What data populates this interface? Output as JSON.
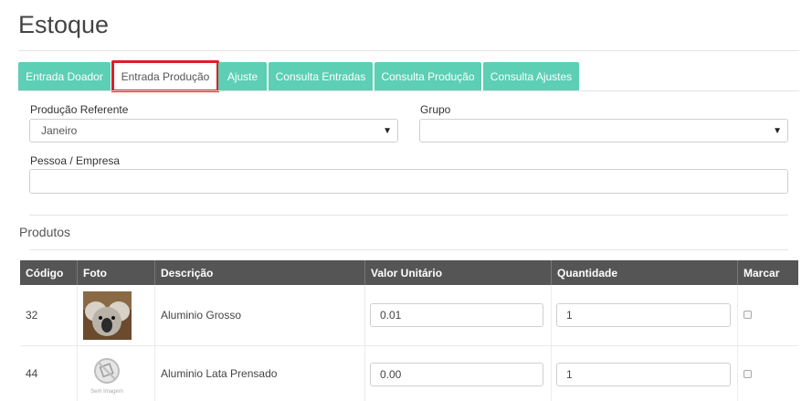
{
  "page": {
    "title": "Estoque"
  },
  "tabs": [
    {
      "label": "Entrada Doador"
    },
    {
      "label": "Entrada Produção"
    },
    {
      "label": "Ajuste"
    },
    {
      "label": "Consulta Entradas"
    },
    {
      "label": "Consulta Produção"
    },
    {
      "label": "Consulta Ajustes"
    }
  ],
  "active_tab": "Entrada Produção",
  "form": {
    "producao_label": "Produção Referente",
    "producao_value": "Janeiro",
    "grupo_label": "Grupo",
    "grupo_value": "",
    "pessoa_label": "Pessoa / Empresa",
    "pessoa_value": ""
  },
  "products": {
    "title": "Produtos",
    "columns": [
      "Código",
      "Foto",
      "Descrição",
      "Valor Unitário",
      "Quantidade",
      "Marcar"
    ],
    "rows": [
      {
        "codigo": "32",
        "foto": "koala-photo",
        "descricao": "Aluminio Grosso",
        "valor": "0.01",
        "quantidade": "1",
        "marcar": false
      },
      {
        "codigo": "44",
        "foto": "sem-imagem",
        "foto_caption": "Sem Imagem",
        "descricao": "Aluminio Lata Prensado",
        "valor": "0.00",
        "quantidade": "1",
        "marcar": false
      }
    ]
  },
  "colors": {
    "tab": "#5ccfb5",
    "active_tab_border": "#e01e24",
    "table_header": "#555555"
  }
}
